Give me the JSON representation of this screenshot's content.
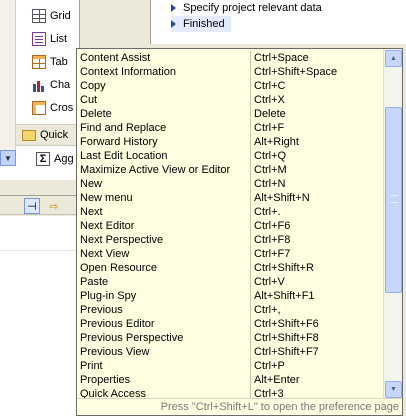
{
  "palette": {
    "items": [
      {
        "label": "Grid",
        "icon": "grid-icon"
      },
      {
        "label": "List",
        "icon": "list-icon"
      },
      {
        "label": "Tab",
        "icon": "table-icon"
      },
      {
        "label": "Cha",
        "icon": "chart-icon"
      },
      {
        "label": "Cros",
        "icon": "crosstab-icon"
      }
    ],
    "quick_label": "Quick",
    "agg_label": "Agg"
  },
  "wizard": {
    "steps": [
      "Specify project relevant data",
      "Finished"
    ]
  },
  "key_assist": {
    "rows": [
      {
        "cmd": "Content Assist",
        "key": "Ctrl+Space"
      },
      {
        "cmd": "Context Information",
        "key": "Ctrl+Shift+Space"
      },
      {
        "cmd": "Copy",
        "key": "Ctrl+C"
      },
      {
        "cmd": "Cut",
        "key": "Ctrl+X"
      },
      {
        "cmd": "Delete",
        "key": "Delete"
      },
      {
        "cmd": "Find and Replace",
        "key": "Ctrl+F"
      },
      {
        "cmd": "Forward History",
        "key": "Alt+Right"
      },
      {
        "cmd": "Last Edit Location",
        "key": "Ctrl+Q"
      },
      {
        "cmd": "Maximize Active View or Editor",
        "key": "Ctrl+M"
      },
      {
        "cmd": "New",
        "key": "Ctrl+N"
      },
      {
        "cmd": "New menu",
        "key": "Alt+Shift+N"
      },
      {
        "cmd": "Next",
        "key": "Ctrl+."
      },
      {
        "cmd": "Next Editor",
        "key": "Ctrl+F6"
      },
      {
        "cmd": "Next Perspective",
        "key": "Ctrl+F8"
      },
      {
        "cmd": "Next View",
        "key": "Ctrl+F7"
      },
      {
        "cmd": "Open Resource",
        "key": "Ctrl+Shift+R"
      },
      {
        "cmd": "Paste",
        "key": "Ctrl+V"
      },
      {
        "cmd": "Plug-in Spy",
        "key": "Alt+Shift+F1"
      },
      {
        "cmd": "Previous",
        "key": "Ctrl+,"
      },
      {
        "cmd": "Previous Editor",
        "key": "Ctrl+Shift+F6"
      },
      {
        "cmd": "Previous Perspective",
        "key": "Ctrl+Shift+F8"
      },
      {
        "cmd": "Previous View",
        "key": "Ctrl+Shift+F7"
      },
      {
        "cmd": "Print",
        "key": "Ctrl+P"
      },
      {
        "cmd": "Properties",
        "key": "Alt+Enter"
      },
      {
        "cmd": "Quick Access",
        "key": "Ctrl+3"
      }
    ],
    "footer": "Press \"Ctrl+Shift+L\" to open the preference page"
  }
}
